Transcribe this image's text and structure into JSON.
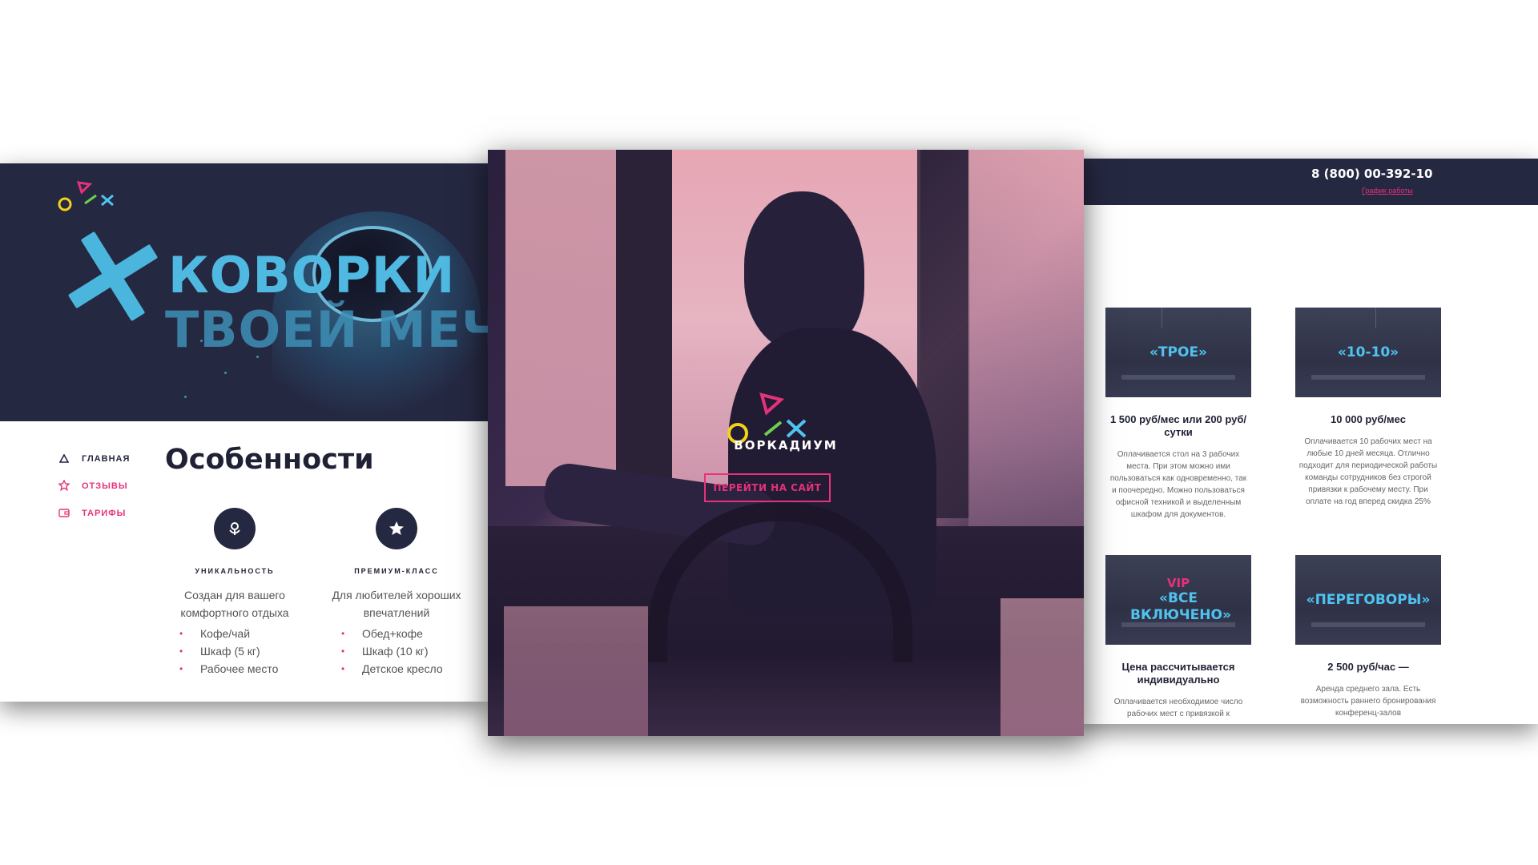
{
  "left_panel": {
    "hero_title": [
      "КОВОРКИ",
      "ТВОЕЙ МЕЧ"
    ],
    "nav": [
      {
        "label": "ГЛАВНАЯ",
        "icon": "triangle-icon",
        "active": true
      },
      {
        "label": "ОТЗЫВЫ",
        "icon": "star-icon",
        "active": false
      },
      {
        "label": "ТАРИФЫ",
        "icon": "wallet-icon",
        "active": false
      }
    ],
    "features_title": "Особенности",
    "features": [
      {
        "icon": "flower-icon",
        "title": "УНИКАЛЬНОСТЬ",
        "desc": "Создан для вашего комфортного отдыха",
        "items": [
          "Кофе/чай",
          "Шкаф (5 кг)",
          "Рабочее место"
        ]
      },
      {
        "icon": "star-icon",
        "title": "ПРЕМИУМ-КЛАСС",
        "desc": "Для любителей хороших впечатлений",
        "items": [
          "Обед+кофе",
          "Шкаф (10 кг)",
          "Детское кресло"
        ]
      }
    ]
  },
  "center_panel": {
    "brand": "ВОРКАДИУМ",
    "cta_label": "ПЕРЕЙТИ НА САЙТ"
  },
  "right_panel": {
    "phone": "8 (800) 00-392-10",
    "schedule_link": "График работы",
    "tariffs": [
      {
        "vip": "",
        "name": "«ТРОЕ»",
        "price": "1 500 руб/мес или 200 руб/сутки",
        "desc": "Оплачивается стол на 3 рабочих места. При этом можно ими пользоваться как одновременно, так и поочередно. Можно пользоваться офисной техникой и выделенным шкафом для документов."
      },
      {
        "vip": "",
        "name": "«10-10»",
        "price": "10 000 руб/мес",
        "desc": "Оплачивается 10 рабочих мест на любые 10 дней месяца. Отлично подходит для периодической работы команды сотрудников без строгой привязки к рабочему месту. При оплате на год вперед скидка 25%"
      },
      {
        "vip": "VIP",
        "name": "«ВСЕ ВКЛЮЧЕНО»",
        "price": "Цена рассчитывается индивидуально",
        "desc": "Оплачивается необходимое число рабочих мест с привязкой к"
      },
      {
        "vip": "",
        "name": "«ПЕРЕГОВОРЫ»",
        "price": "2 500 руб/час —",
        "desc": "Аренда среднего зала. Есть возможность раннего бронирования конференц-залов"
      }
    ]
  },
  "colors": {
    "navy": "#252841",
    "pink": "#e5327a",
    "cyan": "#4fc3f0",
    "yellow": "#f2d21b",
    "green": "#6cd04b"
  }
}
